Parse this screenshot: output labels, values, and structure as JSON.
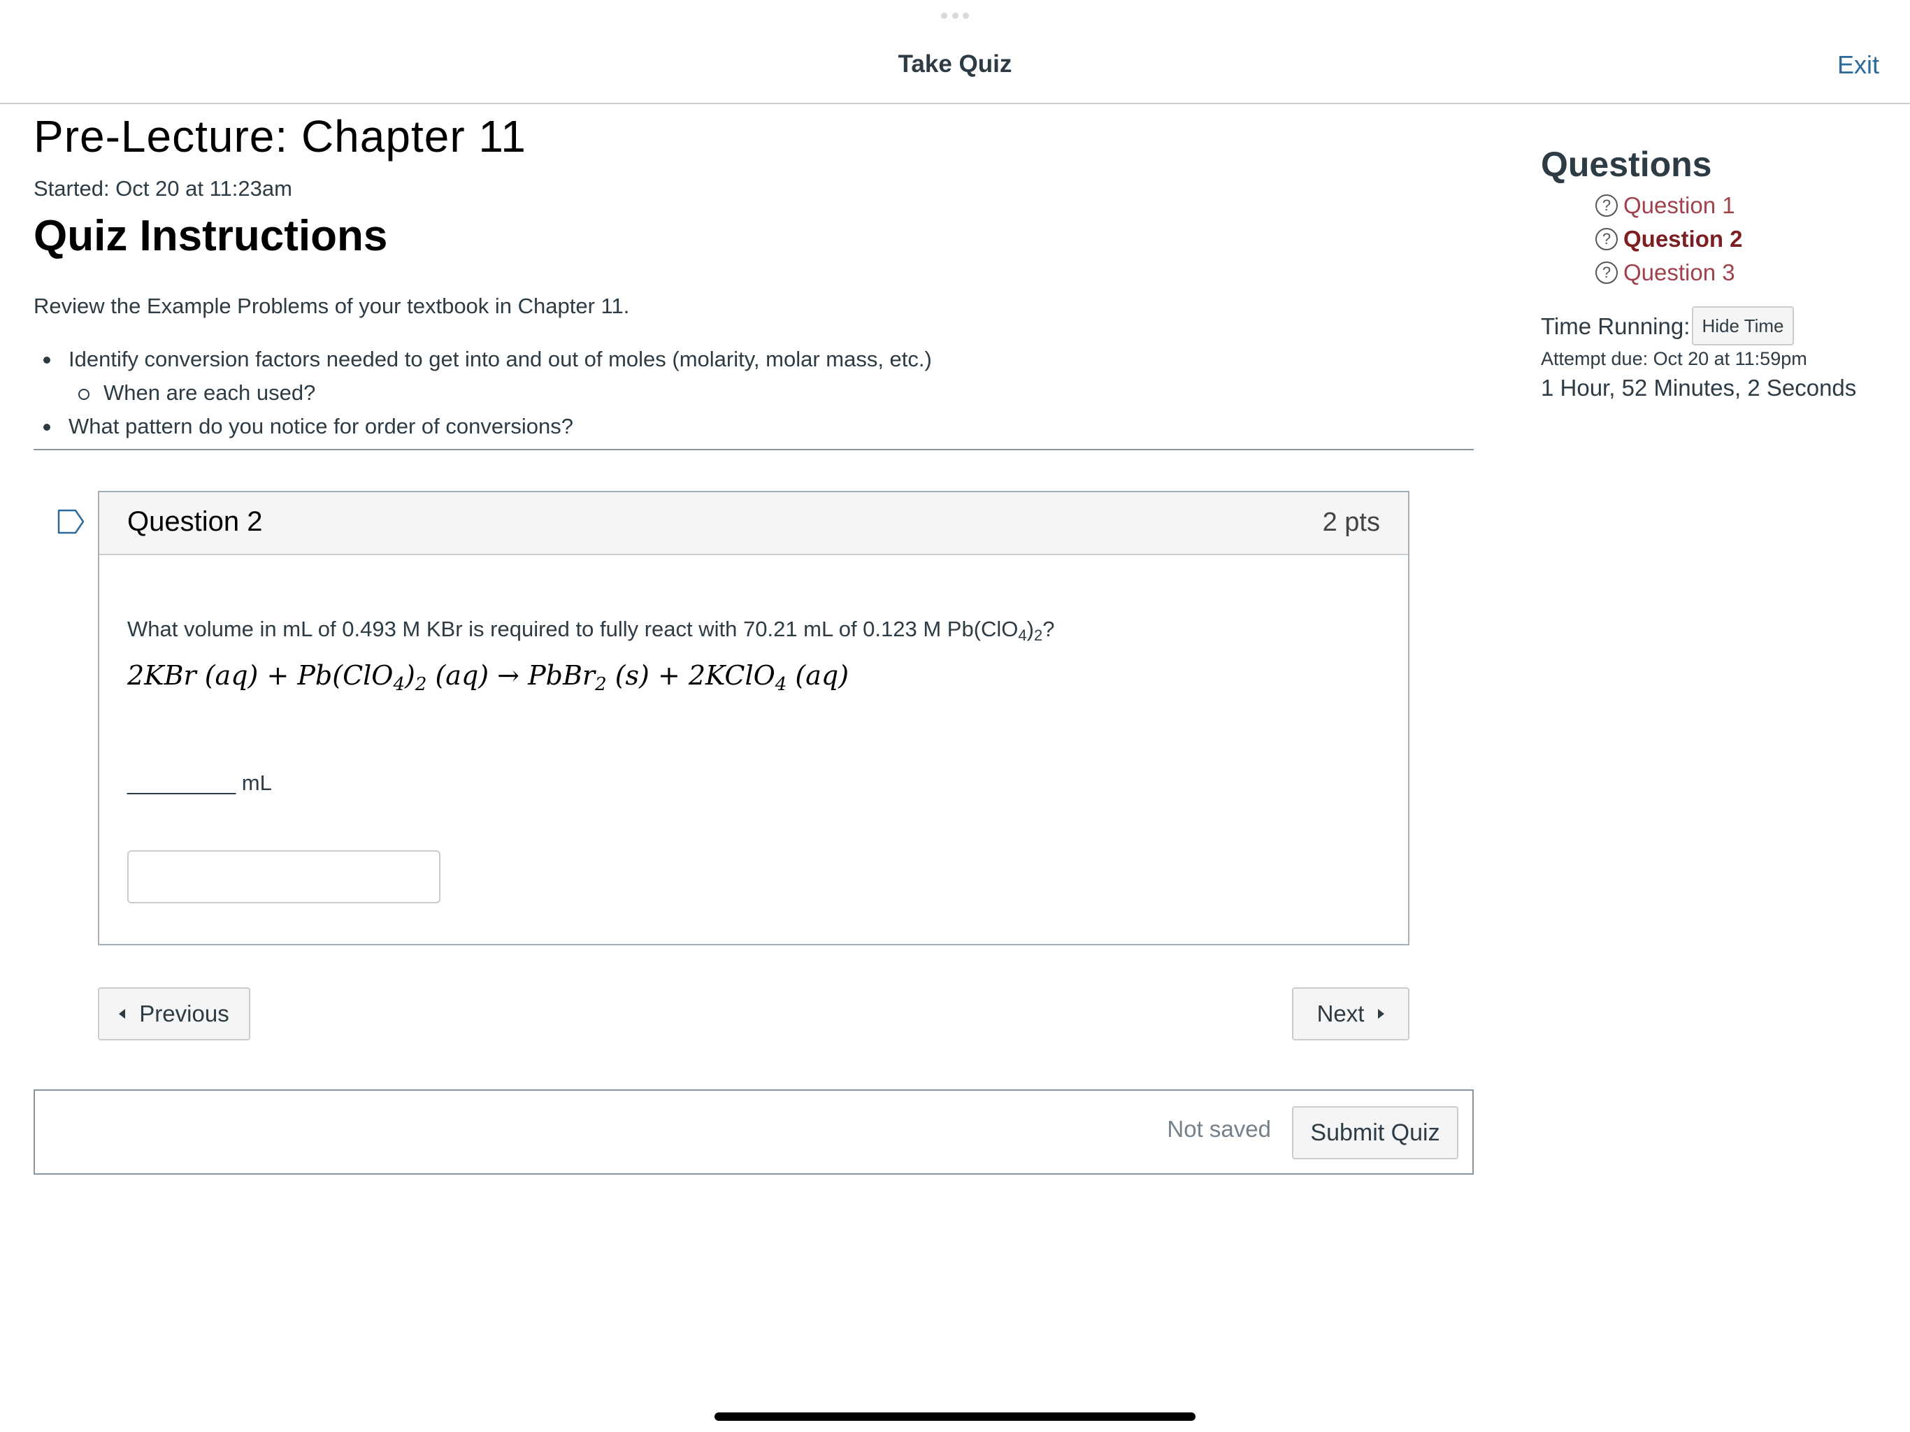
{
  "topbar": {
    "title": "Take Quiz",
    "exit_label": "Exit"
  },
  "quiz": {
    "title": "Pre-Lecture: Chapter 11",
    "started": "Started: Oct 20 at 11:23am"
  },
  "instructions": {
    "heading": "Quiz Instructions",
    "intro": "Review the Example Problems of your textbook in Chapter 11.",
    "bullets": [
      "Identify conversion factors needed to get into and out of moles (molarity, molar mass, etc.)",
      "When are each used?",
      "What pattern do you notice for order of conversions?"
    ]
  },
  "question": {
    "name": "Question 2",
    "points": "2 pts",
    "text_pre": "What volume in mL of 0.493 M KBr is required to fully react with 70.21 mL of 0.123 M Pb(ClO",
    "text_sub1": "4",
    "text_mid": ")",
    "text_sub2": "2",
    "text_post": "?",
    "equation": {
      "part1": "2KBr (aq)  +  Pb(ClO",
      "sub1": "4",
      "part2": ")",
      "sub2": "2",
      "part3": " (aq)  →  PbBr",
      "sub3": "2",
      "part4": " (s)  +  2KClO",
      "sub4": "4",
      "part5": " (aq)"
    },
    "blank_text": "_________ mL",
    "answer_value": ""
  },
  "navigation": {
    "previous_label": "Previous",
    "next_label": "Next"
  },
  "submit": {
    "status": "Not saved",
    "button_label": "Submit Quiz"
  },
  "sidebar": {
    "title": "Questions",
    "items": [
      {
        "label": "Question 1",
        "icon": "question-circle-icon"
      },
      {
        "label": "Question 2",
        "icon": "question-circle-icon"
      },
      {
        "label": "Question 3",
        "icon": "question-circle-icon"
      }
    ],
    "time_label": "Time Running:",
    "hide_time_label": "Hide Time",
    "attempt_due": "Attempt due: Oct 20 at 11:59pm",
    "time_remaining": "1 Hour, 52 Minutes, 2 Seconds"
  },
  "colors": {
    "link": "#2b6a9a",
    "question_link": "#a0424b",
    "question_link_active": "#7b1f22",
    "border": "#c7cdd1"
  }
}
